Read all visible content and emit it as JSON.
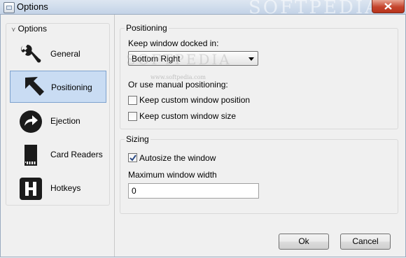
{
  "window": {
    "title": "Options",
    "watermark": "SOFTPEDIA",
    "watermark_small": "www.softpedia.com"
  },
  "sidebar": {
    "header": "Options",
    "items": [
      {
        "label": "General",
        "icon": "wrench-icon",
        "selected": false
      },
      {
        "label": "Positioning",
        "icon": "arrow-up-left-icon",
        "selected": true
      },
      {
        "label": "Ejection",
        "icon": "eject-arrow-icon",
        "selected": false
      },
      {
        "label": "Card Readers",
        "icon": "sd-card-icon",
        "selected": false
      },
      {
        "label": "Hotkeys",
        "icon": "hotkey-h-icon",
        "selected": false
      }
    ]
  },
  "positioning": {
    "title": "Positioning",
    "dock_label": "Keep window docked in:",
    "dock_value": "Bottom Right",
    "manual_label": "Or use manual positioning:",
    "custom_position_label": "Keep custom window position",
    "custom_position_checked": false,
    "custom_size_label": "Keep custom window size",
    "custom_size_checked": false
  },
  "sizing": {
    "title": "Sizing",
    "autosize_label": "Autosize the window",
    "autosize_checked": true,
    "max_width_label": "Maximum window width",
    "max_width_value": "0"
  },
  "buttons": {
    "ok": "Ok",
    "cancel": "Cancel"
  },
  "colors": {
    "selection": "#c9dcf3",
    "selection_border": "#7da2ce",
    "close_button": "#c5452d",
    "titlebar": "#c3d3e7"
  }
}
